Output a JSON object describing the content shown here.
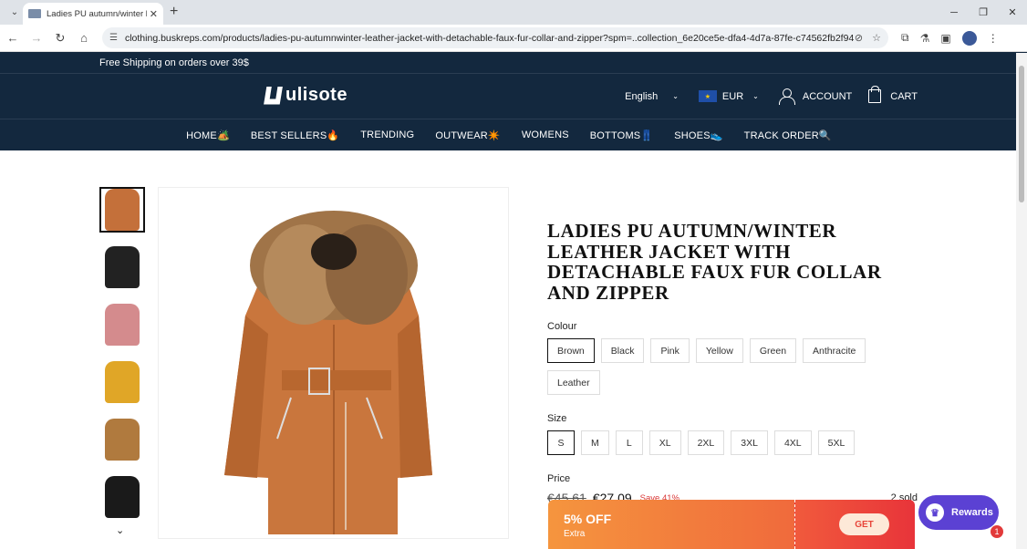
{
  "browser": {
    "tab_title": "Ladies PU autumn/winter leathe",
    "url": "clothing.buskreps.com/products/ladies-pu-autumnwinter-leather-jacket-with-detachable-faux-fur-collar-and-zipper?spm=..collection_6e20ce5e-dfa4-4d7a-87fe-c74562fb2f94.collection_1.1&spm_pr..."
  },
  "announcement": "Free Shipping on orders over 39$",
  "header": {
    "logo": "ulisote",
    "language": "English",
    "currency": "EUR",
    "account": "ACCOUNT",
    "cart": "CART"
  },
  "menu": [
    "HOME🏕️",
    "BEST SELLERS🔥",
    "TRENDING",
    "OUTWEAR✴️",
    "WOMENS",
    "BOTTOMS👖",
    "SHOES👟",
    "TRACK ORDER🔍"
  ],
  "thumbnails": [
    {
      "color": "#c4703a",
      "selected": true
    },
    {
      "color": "#222222",
      "selected": false
    },
    {
      "color": "#d48b8d",
      "selected": false
    },
    {
      "color": "#e0a627",
      "selected": false
    },
    {
      "color": "#b07a3e",
      "selected": false
    },
    {
      "color": "#1a1a1a",
      "selected": false
    }
  ],
  "product": {
    "title": "LADIES PU AUTUMN/WINTER LEATHER JACKET WITH DETACHABLE FAUX FUR COLLAR AND ZIPPER",
    "colour_label": "Colour",
    "colours": [
      "Brown",
      "Black",
      "Pink",
      "Yellow",
      "Green",
      "Anthracite",
      "Leather"
    ],
    "selected_colour": "Brown",
    "size_label": "Size",
    "sizes": [
      "S",
      "M",
      "L",
      "XL",
      "2XL",
      "3XL",
      "4XL",
      "5XL"
    ],
    "selected_size": "S",
    "price_label": "Price",
    "old_price": "€45.61",
    "new_price": "€27.09",
    "save": "Save 41%",
    "sold": "2 sold"
  },
  "coupon": {
    "off": "5% OFF",
    "extra": "Extra",
    "get": "GET"
  },
  "rewards": {
    "label": "Rewards",
    "badge": "1"
  },
  "colors": {
    "nav_bg": "#13283e",
    "coupon": "#f06a3c",
    "rewards": "#5b41d3",
    "save": "#d93636"
  }
}
